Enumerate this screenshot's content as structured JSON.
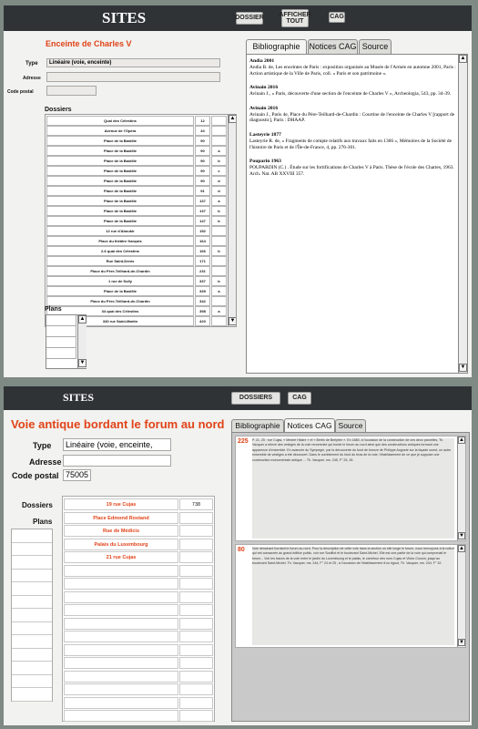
{
  "top": {
    "title": "SITES",
    "buttons": [
      "DOSSIER",
      "AFFICHER TOUT",
      "CAG"
    ],
    "site_title": "Enceinte de Charles V",
    "labels": {
      "type": "Type",
      "adresse": "Adresse",
      "code_postal": "Code postal",
      "dossiers": "Dossiers",
      "plans": "Plans"
    },
    "type_value": "Linéaire (voie, enceinte)",
    "adresse_value": "",
    "code_postal_value": "",
    "tabs": [
      "Bibliographie",
      "Notices CAG",
      "Source"
    ],
    "active_tab": 0,
    "dossiers": [
      {
        "addr": "Quai des Célestins",
        "num": "12",
        "suf": ""
      },
      {
        "addr": "Avenue de l'Opéra",
        "num": "34",
        "suf": ""
      },
      {
        "addr": "Place de la Bastille",
        "num": "90",
        "suf": ""
      },
      {
        "addr": "Place de la Bastille",
        "num": "90",
        "suf": "a"
      },
      {
        "addr": "Place de la Bastille",
        "num": "90",
        "suf": "b"
      },
      {
        "addr": "Place de la Bastille",
        "num": "90",
        "suf": "c"
      },
      {
        "addr": "Place de la Bastille",
        "num": "90",
        "suf": "d"
      },
      {
        "addr": "Place de la Bastille",
        "num": "91",
        "suf": "d"
      },
      {
        "addr": "Place de la Bastille",
        "num": "137",
        "suf": "a"
      },
      {
        "addr": "Place de la Bastille",
        "num": "137",
        "suf": "b"
      },
      {
        "addr": "Place de la Bastille",
        "num": "147",
        "suf": "b"
      },
      {
        "addr": "12 rue d'Aboukir",
        "num": "152",
        "suf": ""
      },
      {
        "addr": "Place du théâtre français",
        "num": "164",
        "suf": ""
      },
      {
        "addr": "2-6 quai des Célestins",
        "num": "166",
        "suf": "b"
      },
      {
        "addr": "Rue Saint-Denis",
        "num": "171",
        "suf": ""
      },
      {
        "addr": "Place du Père-Teilhard-de-Chardin",
        "num": "231",
        "suf": ""
      },
      {
        "addr": "1 rue de Sully",
        "num": "337",
        "suf": "b"
      },
      {
        "addr": "Place de la Bastille",
        "num": "339",
        "suf": "a"
      },
      {
        "addr": "Place du Père-Teilhard-de-Chardin",
        "num": "342",
        "suf": ""
      },
      {
        "addr": "34 quai des Célestins",
        "num": "398",
        "suf": "a"
      },
      {
        "addr": "340 rue Saint-Martin",
        "num": "420",
        "suf": ""
      }
    ],
    "bibliography": [
      {
        "head": "Andia 2001",
        "body": "Andia B. de, Les enceintes de Paris : exposition organisée au Musée de l'Armée en automne 2001, Paris : Action artistique de la Ville de Paris, coll. « Paris et son patrimoine »."
      },
      {
        "head": "Avinain 2016",
        "body": "Avinain J., « Paris, découverte d'une section de l'enceinte de Charles V », Archeologia, 543, pp. 34-39."
      },
      {
        "head": "Avinain 2016",
        "body": "Avinain J., Paris 4e, Place du Père-Teilhard-de-Chardin : Courtine de l'enceinte de Charles V [rapport de diagnostic], Paris : DHAAP."
      },
      {
        "head": "Lasteyrie 1877",
        "body": "Lasteyrie R. de, « Fragments de compte relatifs aux travaux faits en 1366 », Mémoires de la Société de l'histoire de Paris et de l'Île-de-France, 4, pp. 276-301."
      },
      {
        "head": "Pouparin 1963",
        "body": "POUPARDIN (C.) .     Étude sur les fortifications de Charles V à Paris. Thèse de l'école des Chartes, 1963. Arch. Nat. AB XXVIII 357."
      }
    ]
  },
  "bottom": {
    "title": "SITES",
    "buttons": [
      "DOSSIERS",
      "CAG"
    ],
    "site_title": "Voie antique bordant le forum au nord",
    "labels": {
      "type": "Type",
      "adresse": "Adresse",
      "code_postal": "Code postal",
      "dossiers": "Dossiers",
      "plans": "Plans"
    },
    "type_value": "Linéaire (voie, enceinte,",
    "adresse_value": "",
    "code_postal_value": "75005",
    "tabs": [
      "Bibliographie",
      "Notices CAG",
      "Source"
    ],
    "active_tab": 1,
    "dossiers": [
      {
        "addr": "19 rue Cujas",
        "num": "738"
      },
      {
        "addr": "Place Edmond Rostand",
        "num": ""
      },
      {
        "addr": "Rue de Médicis",
        "num": ""
      },
      {
        "addr": "Palais du Luxembourg",
        "num": ""
      },
      {
        "addr": "21 rue Cujas",
        "num": ""
      }
    ],
    "notices": [
      {
        "num": "225",
        "text": "P. 21, 25 : rue Cujas, « Mestre Hilaire » et « Bertin de Beriptier ». En 1880, à l'occasion de la construction de ces deux parcelles, Th. Vacquer a relevé des vestiges de la voie renommée qui borde le forum au nord ainsi que des constructions antiques formant une apparence d'ensemble. En avancée du Sympegie, par la découverte du fond de bronze de Philippe Auguste sur la façade ouest, un autre ensemble de vestiges a été découvert. Dans le comblement du fond du bras de la voie, l'établissement de ce que je suppose une construction monumentale antique ... Th. Vacquer, ms. 245, F° 25, 26."
      },
      {
        "num": "80",
        "text": "Voie dessinant bordant le forum au nord. Pour la description de cette voie dans la section où elle longe le forum, nous renvoyons à la notice qui est consacrée au grand édifice public, voir rue Soufflot et le boulevard Saint-Michel. Elle est une partie de la voie qui comprenait le forum... Voir les traces de la voie entre le jardin du Luxembourg et le palais, le carrefour des rues Cujas et Victor-Cousin, jusqu'au boulevard Saint-Michel. Th. Vacquer, ms. 244, F° 24 et 25 ; à l'occasion de l'établissement d'un égout, Th. Vacquer, ms. 244, F° 32."
      }
    ]
  }
}
